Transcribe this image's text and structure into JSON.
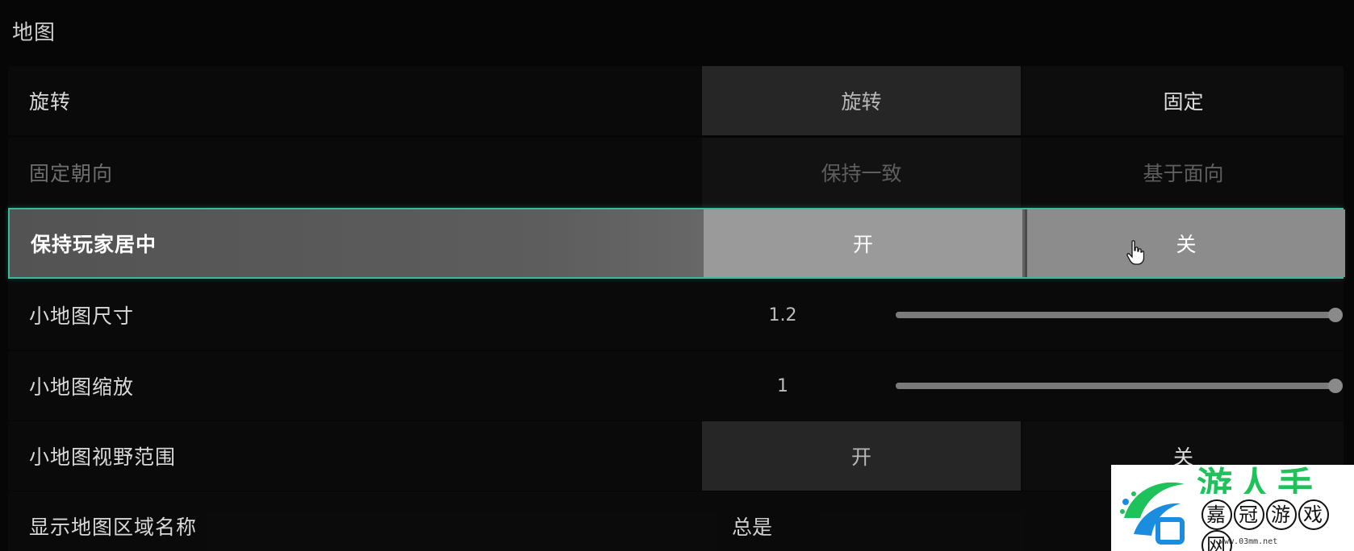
{
  "section": {
    "title": "地图"
  },
  "rows": [
    {
      "label": "旋转",
      "type": "toggle",
      "option_a": "旋转",
      "option_b": "固定",
      "selected": "旋转",
      "state": "normal"
    },
    {
      "label": "固定朝向",
      "type": "toggle",
      "option_a": "保持一致",
      "option_b": "基于面向",
      "selected": "保持一致",
      "state": "disabled"
    },
    {
      "label": "保持玩家居中",
      "type": "toggle",
      "option_a": "开",
      "option_b": "关",
      "selected": "开",
      "state": "focused"
    },
    {
      "label": "小地图尺寸",
      "type": "slider",
      "value": "1.2",
      "fraction": 1.0,
      "state": "normal"
    },
    {
      "label": "小地图缩放",
      "type": "slider",
      "value": "1",
      "fraction": 1.0,
      "state": "normal"
    },
    {
      "label": "小地图视野范围",
      "type": "toggle",
      "option_a": "开",
      "option_b": "关",
      "selected": "开",
      "state": "normal"
    },
    {
      "label": "显示地图区域名称",
      "type": "select",
      "value": "总是",
      "state": "normal"
    }
  ],
  "cursor": {
    "icon": "hand-pointer-icon"
  },
  "watermark": {
    "logo_icon": "swirl-logo-icon",
    "top_text": "游人手游",
    "chars": [
      "嘉",
      "冠",
      "游",
      "戏",
      "网"
    ],
    "url": "www.03mm.net"
  },
  "colors": {
    "focus_border": "#3fb79b",
    "watermark_green": "#1fc15a"
  }
}
